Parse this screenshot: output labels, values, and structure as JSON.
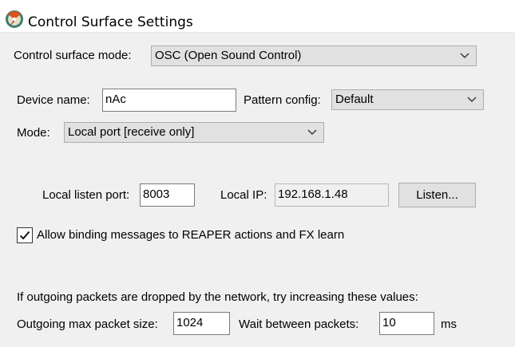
{
  "window": {
    "title": "Control Surface Settings",
    "app_icon": "reaper-logo-icon"
  },
  "surface_mode": {
    "label": "Control surface mode:",
    "value": "OSC (Open Sound Control)"
  },
  "device": {
    "label": "Device name:",
    "value": "nAc"
  },
  "pattern": {
    "label": "Pattern config:",
    "value": "Default"
  },
  "mode": {
    "label": "Mode:",
    "value": "Local port [receive only]"
  },
  "listen_port": {
    "label": "Local listen port:",
    "value": "8003"
  },
  "local_ip": {
    "label": "Local IP:",
    "value": "192.168.1.48"
  },
  "listen_button": {
    "label": "Listen..."
  },
  "binding": {
    "label": "Allow binding messages to REAPER actions and FX learn",
    "checked": true
  },
  "outgoing": {
    "note": "If outgoing packets are dropped by the network, try increasing these values:",
    "max_packet_label": "Outgoing max packet size:",
    "max_packet_value": "1024",
    "wait_label": "Wait between packets:",
    "wait_value": "10",
    "wait_unit": "ms"
  }
}
